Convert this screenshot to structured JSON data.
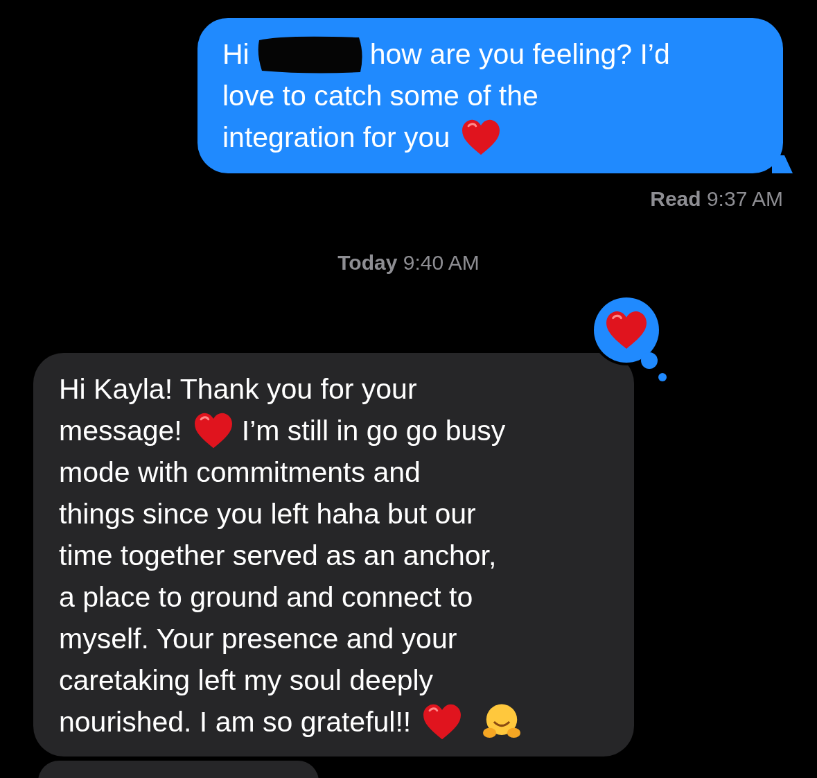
{
  "messages": [
    {
      "kind": "sent",
      "lines": [
        [
          {
            "kind": "text",
            "text": "Hi"
          },
          {
            "kind": "redaction"
          },
          {
            "kind": "text",
            "text": "how are you feeling? I’d"
          }
        ],
        [
          {
            "kind": "text",
            "text": "love to catch some of the"
          }
        ],
        [
          {
            "kind": "text",
            "text": "integration for you"
          },
          {
            "kind": "heart"
          }
        ]
      ],
      "receipt": "**Read** 9:37 AM"
    },
    {
      "kind": "timestamp",
      "text": "**Today** 9:40 AM"
    },
    {
      "kind": "received",
      "reaction": {
        "kind": "heart"
      },
      "lines": [
        [
          {
            "kind": "text",
            "text": "Hi Kayla! Thank you for your"
          }
        ],
        [
          {
            "kind": "text",
            "text": "message!"
          },
          {
            "kind": "heart"
          },
          {
            "kind": "text",
            "text": "I’m still in go go busy"
          }
        ],
        [
          {
            "kind": "text",
            "text": "mode with commitments and"
          }
        ],
        [
          {
            "kind": "text",
            "text": "things since you left haha but our"
          }
        ],
        [
          {
            "kind": "text",
            "text": "time together served as an anchor,"
          }
        ],
        [
          {
            "kind": "text",
            "text": "a place to ground and connect to"
          }
        ],
        [
          {
            "kind": "text",
            "text": "myself. Your presence and your"
          }
        ],
        [
          {
            "kind": "text",
            "text": "caretaking left my soul deeply"
          }
        ],
        [
          {
            "kind": "text",
            "text": "nourished. I am so grateful!!"
          },
          {
            "kind": "heart"
          },
          {
            "kind": "hug"
          }
        ]
      ]
    },
    {
      "kind": "received"
    }
  ]
}
